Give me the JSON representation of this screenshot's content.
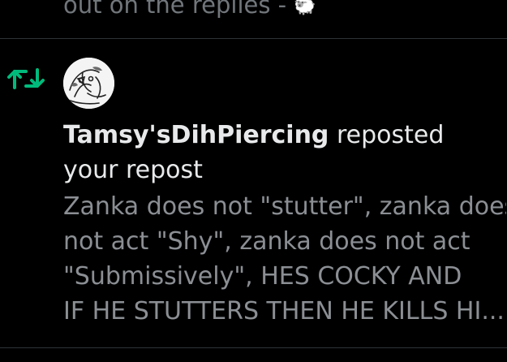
{
  "previous_post": {
    "tail_text": "out on the replies -",
    "emoji": "🐑"
  },
  "notification": {
    "icon": "repost-icon",
    "username": "Tamsy'sDihPiercing",
    "action_text": " reposted your repost",
    "quoted_lines": [
      "Zanka does not \"stutter\", zanka does",
      "not act \"Shy\", zanka does not act",
      "\"Submissively\", HES COCKY AND",
      "IF HE STUTTERS THEN HE KILLS HI..."
    ]
  },
  "colors": {
    "background": "#000000",
    "primary_text": "#e7e9ea",
    "secondary_text": "#8b8f94",
    "repost_green": "#00ba7c",
    "divider": "#2f3336"
  }
}
